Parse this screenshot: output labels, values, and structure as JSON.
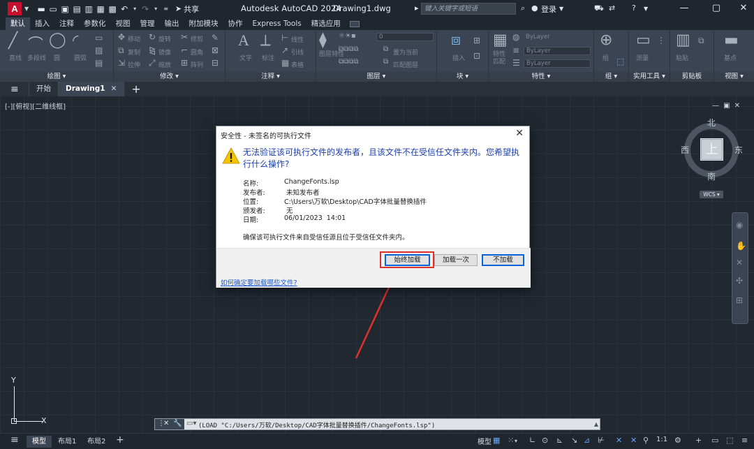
{
  "titlebar": {
    "app_logo": "A",
    "share_label": "共享",
    "app_title": "Autodesk AutoCAD 2024",
    "file_name": "Drawing1.dwg",
    "search_placeholder": "键入关键字或短语",
    "login_label": "登录"
  },
  "ribbon_tabs": [
    "默认",
    "插入",
    "注释",
    "参数化",
    "视图",
    "管理",
    "输出",
    "附加模块",
    "协作",
    "Express Tools",
    "精选应用"
  ],
  "ribbon": {
    "draw": {
      "title": "绘图",
      "labels": [
        "直线",
        "多段线",
        "圆",
        "圆弧"
      ]
    },
    "modify": {
      "title": "修改",
      "labels": [
        "移动",
        "旋转",
        "修剪",
        "复制",
        "镜像",
        "圆角",
        "拉伸",
        "缩放",
        "阵列"
      ]
    },
    "annotation": {
      "title": "注释",
      "labels": [
        "文字",
        "标注",
        "线性",
        "引线",
        "表格"
      ]
    },
    "layers": {
      "title": "图层",
      "labels": [
        "图层特性",
        "置为当前",
        "匹配图层"
      ],
      "current_layer": "0"
    },
    "block": {
      "title": "块",
      "labels": [
        "插入"
      ]
    },
    "properties": {
      "title": "特性",
      "labels": [
        "特性匹配"
      ],
      "bylayer": "ByLayer"
    },
    "groups": {
      "title": "组",
      "labels": [
        "组"
      ]
    },
    "utilities": {
      "title": "实用工具",
      "labels": [
        "测量"
      ]
    },
    "clipboard": {
      "title": "剪贴板",
      "labels": [
        "粘贴"
      ]
    },
    "view": {
      "title": "视图",
      "labels": [
        "基点"
      ]
    }
  },
  "filetabs": {
    "start": "开始",
    "drawing": "Drawing1"
  },
  "canvas": {
    "viewport_label": "[-][俯视][二维线框]",
    "compass": {
      "north": "北",
      "south": "南",
      "east": "东",
      "west": "西",
      "top": "上"
    },
    "wcs_label": "WCS",
    "ucs_x": "X",
    "ucs_y": "Y"
  },
  "dialog": {
    "title": "安全性 - 未签名的可执行文件",
    "heading": "无法验证该可执行文件的发布者，且该文件不在受信任文件夹内。您希望执行什么操作?",
    "fields": [
      {
        "label": "名称:",
        "value": "ChangeFonts.lsp"
      },
      {
        "label": "发布者:",
        "value": "未知发布者"
      },
      {
        "label": "位置:",
        "value": "C:\\Users\\万软\\Desktop\\CAD字体批量替换插件"
      },
      {
        "label": "颁发者:",
        "value": "无"
      },
      {
        "label": "日期:",
        "value": "06/01/2023  14:01"
      }
    ],
    "note": "确保该可执行文件来自受信任源且位于受信任文件夹内。",
    "buttons": {
      "always_load": "始终加载",
      "load_once": "加载一次",
      "do_not_load": "不加载"
    },
    "help_link": "如何确定要加载哪些文件?"
  },
  "command_line": {
    "text": "(LOAD \"C:/Users/万软/Desktop/CAD字体批量替换插件/ChangeFonts.lsp\")"
  },
  "statusbar": {
    "tabs": [
      "模型",
      "布局1",
      "布局2"
    ],
    "model_label": "模型",
    "scale": "1:1"
  }
}
